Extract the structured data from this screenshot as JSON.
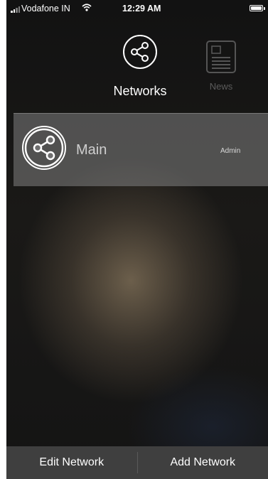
{
  "status_bar": {
    "carrier": "Vodafone IN",
    "time": "12:29 AM",
    "icons": [
      "signal-icon",
      "wifi-icon",
      "battery-icon"
    ]
  },
  "tabs": [
    {
      "label": "Networks",
      "icon": "share-network-icon",
      "active": true
    },
    {
      "label": "News",
      "icon": "news-document-icon",
      "active": false
    }
  ],
  "networks": [
    {
      "name": "Main",
      "role": "Admin",
      "icon": "share-network-icon"
    }
  ],
  "bottom_bar": {
    "edit_label": "Edit Network",
    "add_label": "Add Network"
  },
  "colors": {
    "background": "#141414",
    "bottom_bar": "#3f3f3f",
    "row_highlight": "#8a8a8a",
    "active_text": "#ffffff",
    "inactive_text": "#5b5b5b"
  }
}
